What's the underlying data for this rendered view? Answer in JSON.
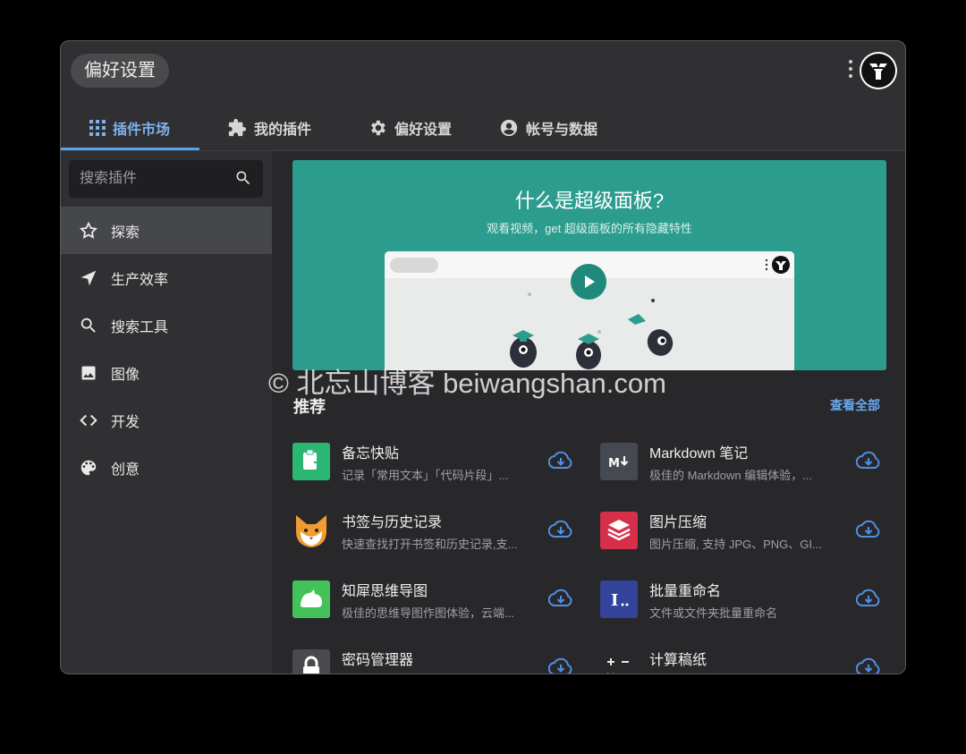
{
  "window": {
    "title": "偏好设置"
  },
  "tabs": [
    {
      "label": "插件市场",
      "icon": "apps-grid-icon",
      "active": true
    },
    {
      "label": "我的插件",
      "icon": "puzzle-icon",
      "active": false
    },
    {
      "label": "偏好设置",
      "icon": "gear-icon",
      "active": false
    },
    {
      "label": "帐号与数据",
      "icon": "account-circle-icon",
      "active": false
    }
  ],
  "sidebar": {
    "search_placeholder": "搜索插件",
    "items": [
      {
        "label": "探索",
        "icon": "star-outline-icon",
        "active": true
      },
      {
        "label": "生产效率",
        "icon": "paper-plane-icon",
        "active": false
      },
      {
        "label": "搜索工具",
        "icon": "search-icon",
        "active": false
      },
      {
        "label": "图像",
        "icon": "image-icon",
        "active": false
      },
      {
        "label": "开发",
        "icon": "code-icon",
        "active": false
      },
      {
        "label": "创意",
        "icon": "palette-icon",
        "active": false
      }
    ]
  },
  "banner": {
    "title": "什么是超级面板?",
    "subtitle": "观看视频，get 超级面板的所有隐藏特性"
  },
  "recommend": {
    "title": "推荐",
    "see_all": "查看全部",
    "plugins": [
      {
        "name": "备忘快贴",
        "desc": "记录「常用文本」「代码片段」...",
        "icon": "clipboard-icon",
        "color": "#2bb673"
      },
      {
        "name": "Markdown 笔记",
        "desc": "极佳的 Markdown 编辑体验，...",
        "icon": "markdown-icon",
        "color": "#454a52"
      },
      {
        "name": "书签与历史记录",
        "desc": "快速查找打开书签和历史记录,支...",
        "icon": "fox-icon",
        "color": "#28282b"
      },
      {
        "name": "图片压缩",
        "desc": "图片压缩, 支持 JPG、PNG、GI...",
        "icon": "layers-icon",
        "color": "#d52f4a"
      },
      {
        "name": "知犀思维导图",
        "desc": "极佳的思维导图作图体验，云端...",
        "icon": "rhino-icon",
        "color": "#43c25a"
      },
      {
        "name": "批量重命名",
        "desc": "文件或文件夹批量重命名",
        "icon": "rename-icon",
        "color": "#33439c"
      },
      {
        "name": "密码管理器",
        "desc": "",
        "icon": "lock-icon",
        "color": "#4a4a4d"
      },
      {
        "name": "计算稿纸",
        "desc": "",
        "icon": "calculator-icon",
        "color": "#28282b"
      }
    ]
  },
  "watermark": "© 北忘山博客 beiwangshan.com",
  "colors": {
    "accent": "#5aa0ee",
    "banner": "#2c9c8e",
    "download": "#4f90e3"
  }
}
